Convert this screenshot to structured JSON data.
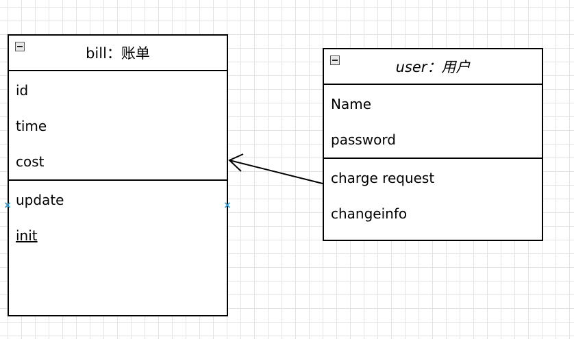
{
  "diagram": {
    "classes": [
      {
        "id": "bill",
        "title": "bill：账单",
        "italic": false,
        "attributes": [
          "id",
          "time",
          "cost"
        ],
        "operations": [
          {
            "label": "update",
            "static": false
          },
          {
            "label": "init",
            "static": true
          }
        ]
      },
      {
        "id": "user",
        "title": "user：用户",
        "italic": true,
        "attributes": [
          "Name",
          "password"
        ],
        "operations": [
          {
            "label": "charge request",
            "static": false
          },
          {
            "label": "changeinfo",
            "static": false
          }
        ]
      }
    ],
    "relation": {
      "from": "user",
      "to": "bill",
      "type": "association-arrow"
    },
    "connection_marker_icon": "x-mark",
    "colors": {
      "grid": "#e3e3e3",
      "line": "#000000",
      "marker": "#2a9fd6",
      "collapse_button": "#e8e8e8"
    }
  }
}
